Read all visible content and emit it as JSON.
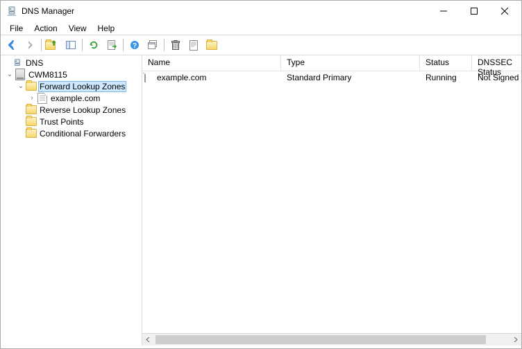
{
  "titlebar": {
    "title": "DNS Manager"
  },
  "menubar": {
    "items": [
      "File",
      "Action",
      "View",
      "Help"
    ]
  },
  "toolbar": {
    "back": "Back",
    "forward": "Forward",
    "up": "Up One Level",
    "show_hide": "Show/Hide Console Tree",
    "refresh": "Refresh",
    "export": "Export List",
    "help": "Help",
    "new_window": "New Window from Here",
    "delete": "Delete",
    "properties": "Properties",
    "configure": "Configure a DNS Server"
  },
  "tree": {
    "root": "DNS",
    "server": "CWM8115",
    "flz": "Forward Lookup Zones",
    "zone": "example.com",
    "rlz": "Reverse Lookup Zones",
    "tp": "Trust Points",
    "cf": "Conditional Forwarders"
  },
  "columns": {
    "name": "Name",
    "type": "Type",
    "status": "Status",
    "dnssec": "DNSSEC Status"
  },
  "rows": [
    {
      "name": "example.com",
      "type": "Standard Primary",
      "status": "Running",
      "dnssec": "Not Signed"
    }
  ],
  "col_widths": {
    "name": 200,
    "type": 200,
    "status": 75,
    "dnssec": 100
  }
}
